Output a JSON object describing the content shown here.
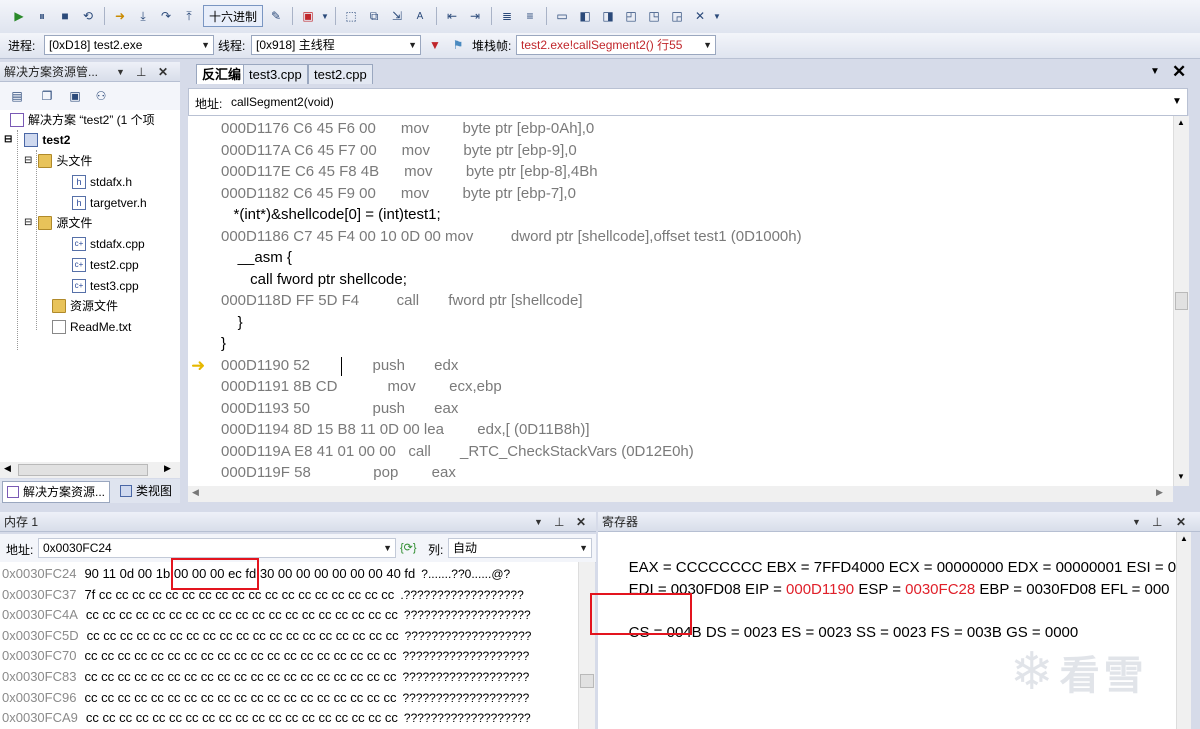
{
  "toolbar1": {
    "hex_label": "十六进制"
  },
  "toolbar2": {
    "process_label": "进程:",
    "process_value": "[0xD18] test2.exe",
    "thread_label": "线程:",
    "thread_value": "[0x918] 主线程",
    "stackframe_label": "堆栈帧:",
    "stackframe_value": "test2.exe!callSegment2()  行55"
  },
  "solution_explorer": {
    "title": "解决方案资源管...",
    "items": [
      {
        "label": "解决方案 “test2” (1 个项",
        "icon": "solution-icon"
      },
      {
        "label": "test2",
        "icon": "project-icon"
      },
      {
        "label": "头文件",
        "icon": "folder-icon"
      },
      {
        "label": "stdafx.h",
        "icon": "header-file-icon"
      },
      {
        "label": "targetver.h",
        "icon": "header-file-icon"
      },
      {
        "label": "源文件",
        "icon": "folder-icon"
      },
      {
        "label": "stdafx.cpp",
        "icon": "cpp-file-icon"
      },
      {
        "label": "test2.cpp",
        "icon": "cpp-file-icon"
      },
      {
        "label": "test3.cpp",
        "icon": "cpp-file-icon"
      },
      {
        "label": "资源文件",
        "icon": "folder-icon"
      },
      {
        "label": "ReadMe.txt",
        "icon": "text-file-icon"
      }
    ],
    "bottom_tab_1": "解决方案资源...",
    "bottom_tab_2": "类视图"
  },
  "editor": {
    "tabs": [
      "反汇编",
      "test3.cpp",
      "test2.cpp"
    ],
    "address_label": "地址:",
    "address_value": "callSegment2(void)",
    "lines": [
      {
        "kind": "asm",
        "text": "000D1176 C6 45 F6 00      mov        byte ptr [ebp-0Ah],0"
      },
      {
        "kind": "asm",
        "text": "000D117A C6 45 F7 00      mov        byte ptr [ebp-9],0"
      },
      {
        "kind": "asm",
        "text": "000D117E C6 45 F8 4B      mov        byte ptr [ebp-8],4Bh"
      },
      {
        "kind": "asm",
        "text": "000D1182 C6 45 F9 00      mov        byte ptr [ebp-7],0"
      },
      {
        "kind": "src",
        "text": "   *(int*)&shellcode[0] = (int)test1;"
      },
      {
        "kind": "asm",
        "text": "000D1186 C7 45 F4 00 10 0D 00 mov         dword ptr [shellcode],offset test1 (0D1000h)"
      },
      {
        "kind": "src",
        "text": "    __asm {"
      },
      {
        "kind": "src",
        "text": "       call fword ptr shellcode;"
      },
      {
        "kind": "asm",
        "text": "000D118D FF 5D F4         call       fword ptr [shellcode]"
      },
      {
        "kind": "src",
        "text": "    }"
      },
      {
        "kind": "src",
        "text": "}"
      },
      {
        "kind": "asm",
        "text": "000D1190 52               push       edx"
      },
      {
        "kind": "asm",
        "text": "000D1191 8B CD            mov        ecx,ebp"
      },
      {
        "kind": "asm",
        "text": "000D1193 50               push       eax"
      },
      {
        "kind": "asm",
        "text": "000D1194 8D 15 B8 11 0D 00 lea        edx,[ (0D11B8h)]"
      },
      {
        "kind": "asm",
        "text": "000D119A E8 41 01 00 00   call       _RTC_CheckStackVars (0D12E0h)"
      },
      {
        "kind": "asm",
        "text": "000D119F 58               pop        eax"
      }
    ]
  },
  "memory": {
    "title": "内存 1",
    "address_label": "地址:",
    "address_value": "0x0030FC24",
    "columns_label": "列:",
    "columns_value": "自动",
    "rows": [
      {
        "addr": "0x0030FC24",
        "bytes": "90 11 0d 00 1b 00 00 00 ec fd 30 00 00 00 00 00 00 40 fd",
        "ascii": "?.......??0......@?"
      },
      {
        "addr": "0x0030FC37",
        "bytes": "7f cc cc cc cc cc cc cc cc cc cc cc cc cc cc cc cc cc cc",
        "ascii": ".??????????????????"
      },
      {
        "addr": "0x0030FC4A",
        "bytes": "cc cc cc cc cc cc cc cc cc cc cc cc cc cc cc cc cc cc cc",
        "ascii": "???????????????????"
      },
      {
        "addr": "0x0030FC5D",
        "bytes": "cc cc cc cc cc cc cc cc cc cc cc cc cc cc cc cc cc cc cc",
        "ascii": "???????????????????"
      },
      {
        "addr": "0x0030FC70",
        "bytes": "cc cc cc cc cc cc cc cc cc cc cc cc cc cc cc cc cc cc cc",
        "ascii": "???????????????????"
      },
      {
        "addr": "0x0030FC83",
        "bytes": "cc cc cc cc cc cc cc cc cc cc cc cc cc cc cc cc cc cc cc",
        "ascii": "???????????????????"
      },
      {
        "addr": "0x0030FC96",
        "bytes": "cc cc cc cc cc cc cc cc cc cc cc cc cc cc cc cc cc cc cc",
        "ascii": "???????????????????"
      },
      {
        "addr": "0x0030FCA9",
        "bytes": "cc cc cc cc cc cc cc cc cc cc cc cc cc cc cc cc cc cc cc",
        "ascii": "???????????????????"
      }
    ]
  },
  "registers": {
    "title": "寄存器",
    "row1": {
      "eax": "EAX = CCCCCCCC",
      "ebx": "EBX = 7FFD4000",
      "ecx": "ECX = 00000000",
      "edx": "EDX = 00000001",
      "esi": "ESI = 0"
    },
    "row2": {
      "edi": "EDI = 0030FD08",
      "eip_label": "EIP = ",
      "eip_value": "000D1190",
      "esp_label": "ESP = ",
      "esp_value": "0030FC28",
      "ebp": "EBP = 0030FD08",
      "efl": "EFL = 000"
    },
    "row3": {
      "cs": "CS = 004B",
      "ds": "DS = 0023",
      "es": "ES = 0023",
      "ss": "SS = 0023",
      "fs": "FS = 003B",
      "gs": "GS = 0000"
    }
  },
  "watermark": "看雪",
  "colors": {
    "highlight_red": "#e3141e",
    "changed_register": "#e0202a",
    "asm_gray": "#7a7a7a"
  }
}
